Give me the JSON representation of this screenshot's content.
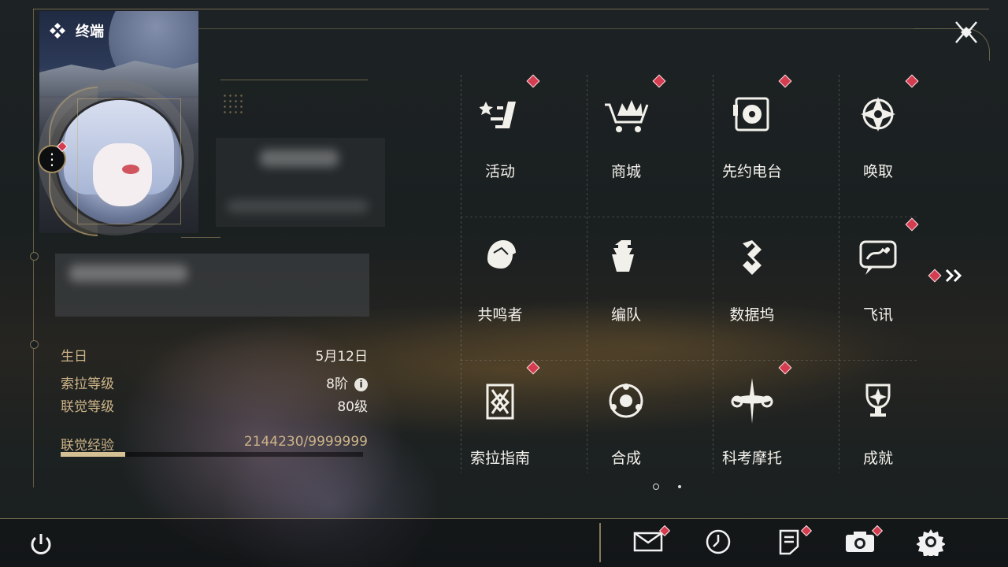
{
  "window": {
    "title": "终端"
  },
  "profile": {
    "stats": [
      {
        "label": "生日",
        "value": "5月12日"
      },
      {
        "label": "索拉等级",
        "value": "8阶"
      },
      {
        "label": "联觉等级",
        "value": "80级"
      }
    ],
    "xp": {
      "label": "联觉经验",
      "value": "2144230/9999999",
      "progress": 0.2144
    }
  },
  "menu": {
    "items": [
      {
        "label": "活动",
        "icon": "activity-icon",
        "badge": true
      },
      {
        "label": "商城",
        "icon": "shop-cart-icon",
        "badge": true
      },
      {
        "label": "先约电台",
        "icon": "radio-icon",
        "badge": true
      },
      {
        "label": "唤取",
        "icon": "convene-icon",
        "badge": true
      },
      {
        "label": "共鸣者",
        "icon": "resonator-icon",
        "badge": false
      },
      {
        "label": "编队",
        "icon": "team-chess-icon",
        "badge": false
      },
      {
        "label": "数据坞",
        "icon": "data-bank-icon",
        "badge": false
      },
      {
        "label": "飞讯",
        "icon": "message-bubble-icon",
        "badge": true
      },
      {
        "label": "索拉指南",
        "icon": "guide-icon",
        "badge": true
      },
      {
        "label": "合成",
        "icon": "synthesis-icon",
        "badge": false
      },
      {
        "label": "科考摩托",
        "icon": "motorcycle-icon",
        "badge": true
      },
      {
        "label": "成就",
        "icon": "trophy-icon",
        "badge": false
      }
    ],
    "next_page_icon": "double-chevron-right-icon",
    "page": {
      "current": 1,
      "total": 2
    }
  },
  "bottom_bar": {
    "left": {
      "icon": "power-icon"
    },
    "right": [
      {
        "icon": "mail-icon",
        "badge": true
      },
      {
        "icon": "clock-icon",
        "badge": false
      },
      {
        "icon": "notes-icon",
        "badge": true
      },
      {
        "icon": "camera-icon",
        "badge": true
      },
      {
        "icon": "settings-gear-icon",
        "badge": false
      }
    ]
  },
  "colors": {
    "accent_gold": "#cdb488",
    "badge_red": "#d43d50",
    "text": "#f4f2ec"
  }
}
